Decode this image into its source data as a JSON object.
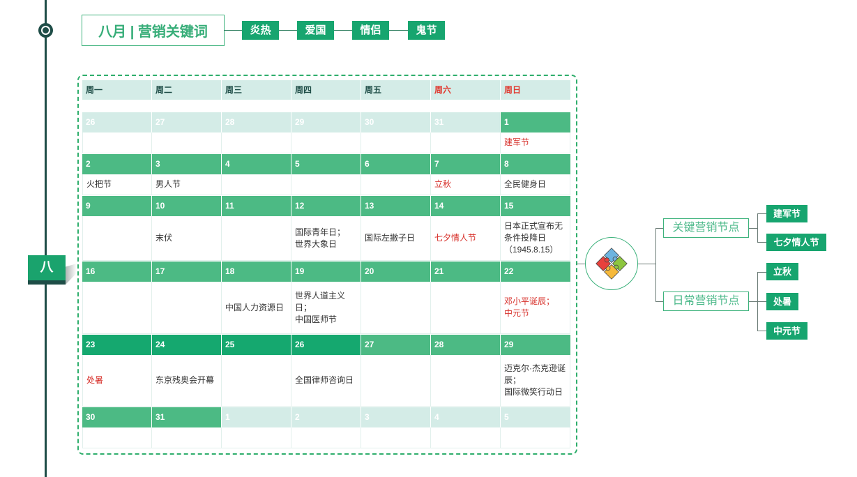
{
  "timeline": {
    "month_tab": "八"
  },
  "title": {
    "text": "八月 | 营销关键词"
  },
  "keywords": [
    "炎热",
    "爱国",
    "情侣",
    "鬼节"
  ],
  "calendar": {
    "weekdays": [
      {
        "label": "周一",
        "weekend": false
      },
      {
        "label": "周二",
        "weekend": false
      },
      {
        "label": "周三",
        "weekend": false
      },
      {
        "label": "周四",
        "weekend": false
      },
      {
        "label": "周五",
        "weekend": false
      },
      {
        "label": "周六",
        "weekend": true
      },
      {
        "label": "周日",
        "weekend": true
      }
    ],
    "weeks": [
      [
        {
          "date": "26",
          "other_month": true
        },
        {
          "date": "27",
          "other_month": true
        },
        {
          "date": "28",
          "other_month": true
        },
        {
          "date": "29",
          "other_month": true
        },
        {
          "date": "30",
          "other_month": true
        },
        {
          "date": "31",
          "other_month": true
        },
        {
          "date": "1",
          "event": {
            "lines": [
              "建军节"
            ],
            "red": true
          }
        }
      ],
      [
        {
          "date": "2",
          "event": {
            "lines": [
              "火把节"
            ],
            "red": false
          }
        },
        {
          "date": "3",
          "event": {
            "lines": [
              "男人节"
            ],
            "red": false
          }
        },
        {
          "date": "4"
        },
        {
          "date": "5"
        },
        {
          "date": "6"
        },
        {
          "date": "7",
          "event": {
            "lines": [
              "立秋"
            ],
            "red": true
          }
        },
        {
          "date": "8",
          "event": {
            "lines": [
              "全民健身日"
            ],
            "red": false
          }
        }
      ],
      [
        {
          "date": "9"
        },
        {
          "date": "10",
          "event": {
            "lines": [
              "末伏"
            ],
            "red": false
          }
        },
        {
          "date": "11"
        },
        {
          "date": "12",
          "event": {
            "lines": [
              "国际青年日；",
              "世界大象日"
            ],
            "red": false
          }
        },
        {
          "date": "13",
          "event": {
            "lines": [
              "国际左撇子日"
            ],
            "red": false
          }
        },
        {
          "date": "14",
          "event": {
            "lines": [
              "七夕情人节"
            ],
            "red": true
          }
        },
        {
          "date": "15",
          "event": {
            "lines": [
              "日本正式宣布无",
              "条件投降日",
              "（1945.8.15）"
            ],
            "red": false
          }
        }
      ],
      [
        {
          "date": "16"
        },
        {
          "date": "17"
        },
        {
          "date": "18",
          "event": {
            "lines": [
              "中国人力资源日"
            ],
            "red": false
          }
        },
        {
          "date": "19",
          "event": {
            "lines": [
              "世界人道主义",
              "日；",
              "中国医师节"
            ],
            "red": false
          }
        },
        {
          "date": "20"
        },
        {
          "date": "21"
        },
        {
          "date": "22",
          "event": {
            "lines": [
              "邓小平诞辰；",
              "中元节"
            ],
            "red": true
          }
        }
      ],
      [
        {
          "date": "23",
          "highlight": true,
          "event": {
            "lines": [
              "处暑"
            ],
            "red": true
          }
        },
        {
          "date": "24",
          "highlight": true,
          "event": {
            "lines": [
              "东京残奥会开幕"
            ],
            "red": false
          }
        },
        {
          "date": "25",
          "highlight": true
        },
        {
          "date": "26",
          "highlight": true,
          "event": {
            "lines": [
              "全国律师咨询日"
            ],
            "red": false
          }
        },
        {
          "date": "27"
        },
        {
          "date": "28"
        },
        {
          "date": "29",
          "event": {
            "lines": [
              "迈克尔·杰克逊诞",
              "辰；",
              "国际微笑行动日"
            ],
            "red": false
          }
        }
      ],
      [
        {
          "date": "30"
        },
        {
          "date": "31"
        },
        {
          "date": "1",
          "other_month": true
        },
        {
          "date": "2",
          "other_month": true
        },
        {
          "date": "3",
          "other_month": true
        },
        {
          "date": "4",
          "other_month": true
        },
        {
          "date": "5",
          "other_month": true
        }
      ]
    ]
  },
  "mindmap": {
    "center_icon": "puzzle-icon",
    "branches": [
      {
        "label": "关键营销节点",
        "items": [
          "建军节",
          "七夕情人节"
        ]
      },
      {
        "label": "日常营销节点",
        "items": [
          "立秋",
          "处暑",
          "中元节"
        ]
      }
    ]
  },
  "colors": {
    "date_bar_green": "#4cba84",
    "tag_green": "#17a56f",
    "timeline_dark": "#1e4d47",
    "header_bg": "#d4ece7",
    "event_red": "#d7302a",
    "weekend_red": "#e0392f"
  }
}
